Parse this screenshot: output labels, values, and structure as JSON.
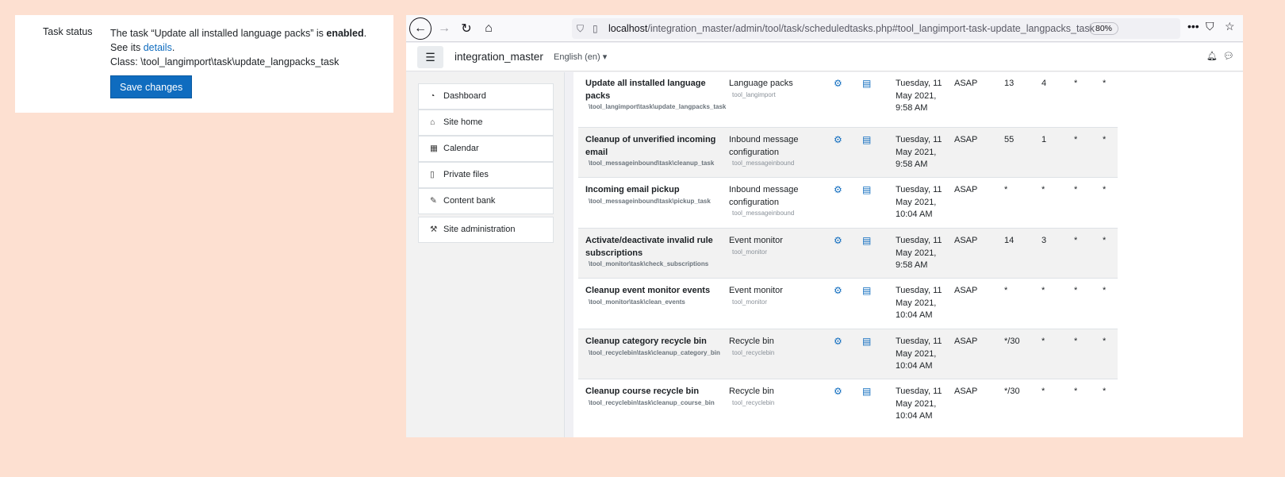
{
  "task_panel": {
    "label": "Task status",
    "line1_prefix": "The task “Update all installed language packs” is ",
    "line1_status": "enabled",
    "line1_suffix": ".",
    "line2_prefix": "See its ",
    "line2_link": "details",
    "line2_suffix": ".",
    "line3": "Class: \\tool_langimport\\task\\update_langpacks_task",
    "save_label": "Save changes"
  },
  "browser": {
    "url_host": "localhost",
    "url_path": "/integration_master/admin/tool/task/scheduledtasks.php#tool_langimport-task-update_langpacks_task",
    "zoom": "80%"
  },
  "navbar": {
    "site_name": "integration_master",
    "language": "English (en)"
  },
  "drawer": {
    "items": [
      {
        "label": "Dashboard",
        "icon": "dashboard-icon"
      },
      {
        "label": "Site home",
        "icon": "home-icon"
      },
      {
        "label": "Calendar",
        "icon": "calendar-icon"
      },
      {
        "label": "Private files",
        "icon": "file-icon"
      },
      {
        "label": "Content bank",
        "icon": "brush-icon"
      },
      {
        "label": "Site administration",
        "icon": "wrench-icon"
      }
    ]
  },
  "tasks": [
    {
      "name": "Update all installed language packs",
      "class": "\\tool_langimport\\task\\update_langpacks_task",
      "component": "Language packs",
      "component_id": "tool_langimport",
      "last_run": "Tuesday, 11 May 2021, 9:58 AM",
      "next_run": "ASAP",
      "minute": "13",
      "hour": "4",
      "day": "*",
      "month": "*"
    },
    {
      "name": "Cleanup of unverified incoming email",
      "class": "\\tool_messageinbound\\task\\cleanup_task",
      "component": "Inbound message configuration",
      "component_id": "tool_messageinbound",
      "last_run": "Tuesday, 11 May 2021, 9:58 AM",
      "next_run": "ASAP",
      "minute": "55",
      "hour": "1",
      "day": "*",
      "month": "*"
    },
    {
      "name": "Incoming email pickup",
      "class": "\\tool_messageinbound\\task\\pickup_task",
      "component": "Inbound message configuration",
      "component_id": "tool_messageinbound",
      "last_run": "Tuesday, 11 May 2021, 10:04 AM",
      "next_run": "ASAP",
      "minute": "*",
      "hour": "*",
      "day": "*",
      "month": "*"
    },
    {
      "name": "Activate/deactivate invalid rule subscriptions",
      "class": "\\tool_monitor\\task\\check_subscriptions",
      "component": "Event monitor",
      "component_id": "tool_monitor",
      "last_run": "Tuesday, 11 May 2021, 9:58 AM",
      "next_run": "ASAP",
      "minute": "14",
      "hour": "3",
      "day": "*",
      "month": "*"
    },
    {
      "name": "Cleanup event monitor events",
      "class": "\\tool_monitor\\task\\clean_events",
      "component": "Event monitor",
      "component_id": "tool_monitor",
      "last_run": "Tuesday, 11 May 2021, 10:04 AM",
      "next_run": "ASAP",
      "minute": "*",
      "hour": "*",
      "day": "*",
      "month": "*"
    },
    {
      "name": "Cleanup category recycle bin",
      "class": "\\tool_recyclebin\\task\\cleanup_category_bin",
      "component": "Recycle bin",
      "component_id": "tool_recyclebin",
      "last_run": "Tuesday, 11 May 2021, 10:04 AM",
      "next_run": "ASAP",
      "minute": "*/30",
      "hour": "*",
      "day": "*",
      "month": "*"
    },
    {
      "name": "Cleanup course recycle bin",
      "class": "\\tool_recyclebin\\task\\cleanup_course_bin",
      "component": "Recycle bin",
      "component_id": "tool_recyclebin",
      "last_run": "Tuesday, 11 May 2021, 10:04 AM",
      "next_run": "ASAP",
      "minute": "*/30",
      "hour": "*",
      "day": "*",
      "month": "*"
    }
  ]
}
